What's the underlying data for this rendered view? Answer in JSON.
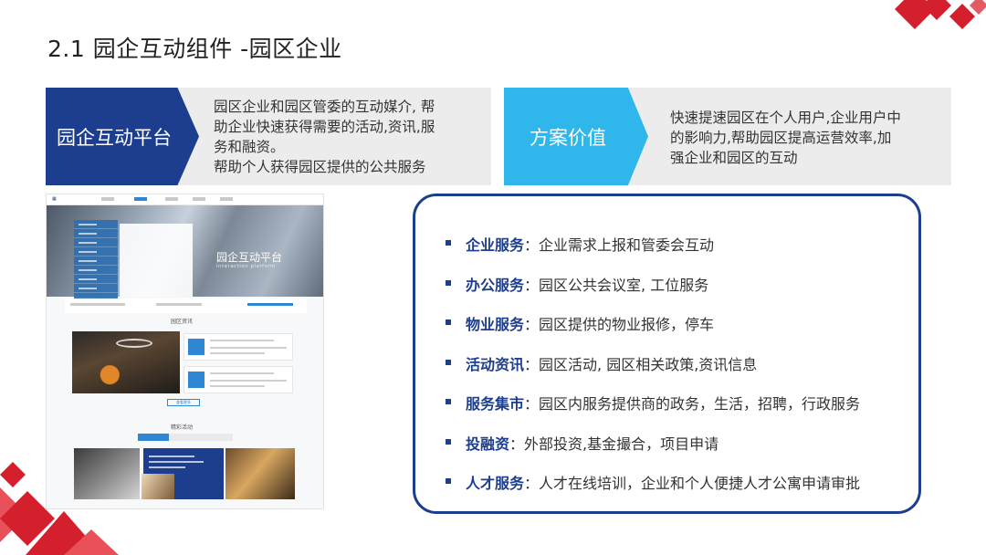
{
  "slide": {
    "title": "2.1 园企互动组件 -园区企业"
  },
  "left_band": {
    "chevron_label": "园企互动平台",
    "line1": "园区企业和园区管委的互动媒介, 帮",
    "line2": "助企业快速获得需要的活动,资讯,服",
    "line3": "务和融资。",
    "line4": "帮助个人获得园区提供的公共服务"
  },
  "right_band": {
    "chevron_label": "方案价值",
    "line1": "快速提速园区在个人用户,企业用户中",
    "line2": "的影响力,帮助园区提高运营效率,加",
    "line3": "强企业和园区的互动"
  },
  "screenshot": {
    "hero_title": "园企互动平台",
    "hero_subtitle": "interaction platform",
    "news_title": "园区资讯",
    "activity_title": "精彩活动",
    "more_label": "查看更多"
  },
  "features": [
    {
      "key": "企业服务",
      "sep": "：",
      "value": "企业需求上报和管委会互动"
    },
    {
      "key": "办公服务",
      "sep": "：",
      "value": " 园区公共会议室, 工位服务"
    },
    {
      "key": "物业服务",
      "sep": "：",
      "value": "园区提供的物业报修，停车"
    },
    {
      "key": "活动资讯",
      "sep": "：",
      "value": "园区活动, 园区相关政策,资讯信息"
    },
    {
      "key": "服务集市",
      "sep": "：",
      "value": "园区内服务提供商的政务，生活，招聘，行政服务"
    },
    {
      "key": "投融资",
      "sep": "：",
      "value": "外部投资,基金撮合，项目申请"
    },
    {
      "key": "人才服务",
      "sep": "：",
      "value": "人才在线培训，企业和个人便捷人才公寓申请审批"
    }
  ],
  "colors": {
    "navy": "#1d3e8e",
    "cyan": "#2fb6ea",
    "red": "#d4202c",
    "band_gray": "#ececec"
  }
}
